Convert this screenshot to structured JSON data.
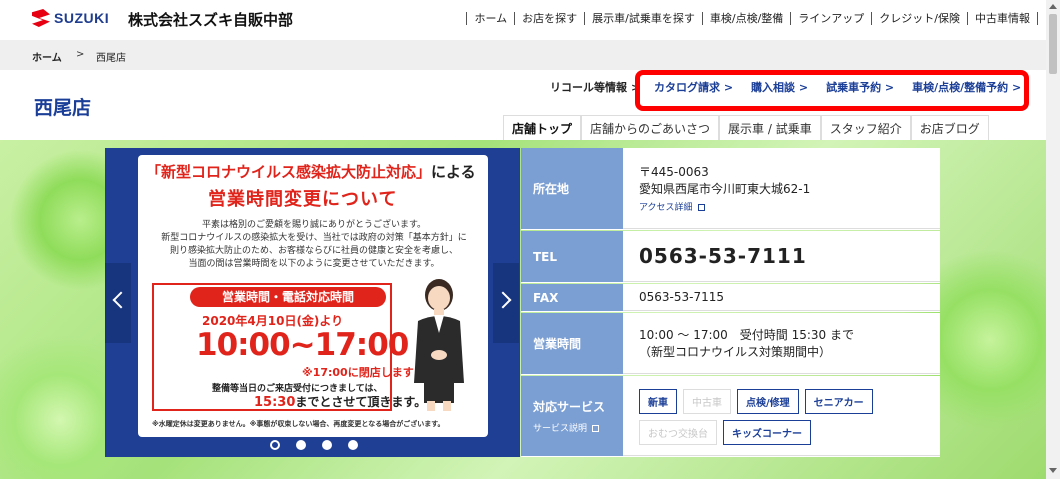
{
  "header": {
    "logo": "SUZUKI",
    "company": "株式会社スズキ自販中部",
    "nav": [
      "ホーム",
      "お店を探す",
      "展示車/試乗車を探す",
      "車検/点検/整備",
      "ラインアップ",
      "クレジット/保険",
      "中古車情報"
    ]
  },
  "breadcrumb": {
    "home": "ホーム",
    "sep": ">",
    "current": "西尾店"
  },
  "shop": {
    "title": "西尾店",
    "recall": "リコール等情報",
    "sublinks": [
      "カタログ請求 >",
      "購入相談 >",
      "試乗車予約 >",
      "車検/点検/整備予約 >"
    ],
    "tabs": [
      "店舗トップ",
      "店舗からのごあいさつ",
      "展示車 / 試乗車",
      "スタッフ紹介",
      "お店ブログ"
    ]
  },
  "banner": {
    "head1_red": "「新型コロナウイルス感染拡大防止対応」",
    "head1_rest": "による",
    "head2": "営業時間変更について",
    "body": [
      "平素は格別のご愛顧を賜り誠にありがとうございます。",
      "新型コロナウイルスの感染拡大を受け、当社では政府の対策「基本方針」に",
      "則り感染拡大防止のため、お客様ならびに社員の健康と安全を考慮し、",
      "当面の間は営業時間を以下のように変更させていただきます。"
    ],
    "pill": "営業時間・電話対応時間",
    "date": "2020年4月10日(金)より",
    "time": "10:00~17:00",
    "close": "※17:00に閉店します",
    "accept1": "整備等当日のご来店受付につきましては、",
    "accept_time": "15:30",
    "accept2": "までとさせて頂きます。",
    "note": "※水曜定休は変更ありません。※事態が収束しない場合、再度変更となる場合がございます。"
  },
  "info": {
    "address_label": "所在地",
    "zip": "〒445-0063",
    "address": "愛知県西尾市今川町東大城62-1",
    "access": "アクセス詳細",
    "tel_label": "TEL",
    "tel": "0563-53-7111",
    "fax_label": "FAX",
    "fax": "0563-53-7115",
    "hours_label": "営業時間",
    "hours1": "10:00 ～ 17:00　受付時間 15:30 まで",
    "hours2": "（新型コロナウイルス対策期間中）",
    "service_label": "対応サービス",
    "service_sub": "サービス説明",
    "services": [
      {
        "label": "新車",
        "active": true
      },
      {
        "label": "中古車",
        "active": false
      },
      {
        "label": "点検/修理",
        "active": true
      },
      {
        "label": "セニアカー",
        "active": true
      },
      {
        "label": "おむつ交換台",
        "active": false
      },
      {
        "label": "キッズコーナー",
        "active": true
      }
    ]
  }
}
